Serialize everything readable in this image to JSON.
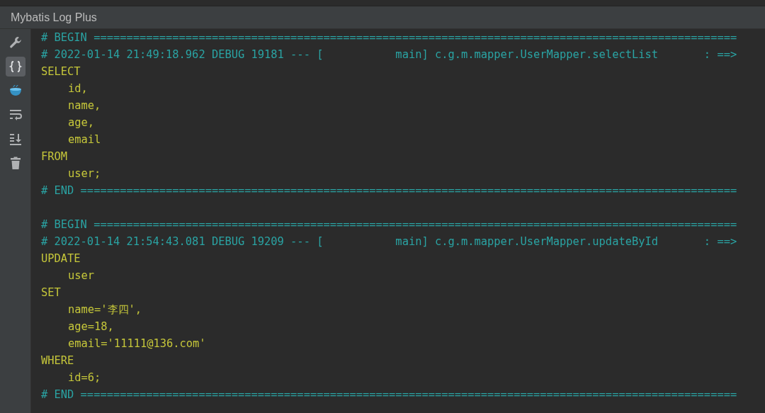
{
  "window": {
    "title": "Mybatis Log Plus"
  },
  "toolbar": [
    {
      "kind": "wrench",
      "selected": false
    },
    {
      "kind": "braces",
      "selected": true
    },
    {
      "kind": "cup",
      "selected": false
    },
    {
      "kind": "wrap",
      "selected": false
    },
    {
      "kind": "scroll-end",
      "selected": false
    },
    {
      "kind": "trash",
      "selected": false
    }
  ],
  "log": [
    {
      "lines": [
        {
          "kind": "marker",
          "text": "# BEGIN =================================================================================================="
        },
        {
          "kind": "marker",
          "text": "# 2022-01-14 21:49:18.962 DEBUG 19181 --- [           main] c.g.m.mapper.UserMapper.selectList       : ==>"
        },
        {
          "kind": "keyword",
          "text": "SELECT"
        },
        {
          "kind": "clause",
          "text": "id,"
        },
        {
          "kind": "clause",
          "text": "name,"
        },
        {
          "kind": "clause",
          "text": "age,"
        },
        {
          "kind": "clause",
          "text": "email"
        },
        {
          "kind": "keyword",
          "text": "FROM"
        },
        {
          "kind": "clause",
          "text": "user;"
        },
        {
          "kind": "marker",
          "text": "# END ===================================================================================================="
        }
      ]
    },
    {
      "lines": [
        {
          "kind": "marker",
          "text": "# BEGIN =================================================================================================="
        },
        {
          "kind": "marker",
          "text": "# 2022-01-14 21:54:43.081 DEBUG 19209 --- [           main] c.g.m.mapper.UserMapper.updateById       : ==>"
        },
        {
          "kind": "keyword",
          "text": "UPDATE"
        },
        {
          "kind": "clause",
          "text": "user"
        },
        {
          "kind": "keyword",
          "text": "SET"
        },
        {
          "kind": "clause",
          "text": "name='李四',"
        },
        {
          "kind": "clause",
          "text": "age=18,"
        },
        {
          "kind": "clause",
          "text": "email='11111@136.com'"
        },
        {
          "kind": "keyword",
          "text": "WHERE"
        },
        {
          "kind": "clause",
          "text": "id=6;"
        },
        {
          "kind": "marker",
          "text": "# END ===================================================================================================="
        }
      ]
    }
  ]
}
